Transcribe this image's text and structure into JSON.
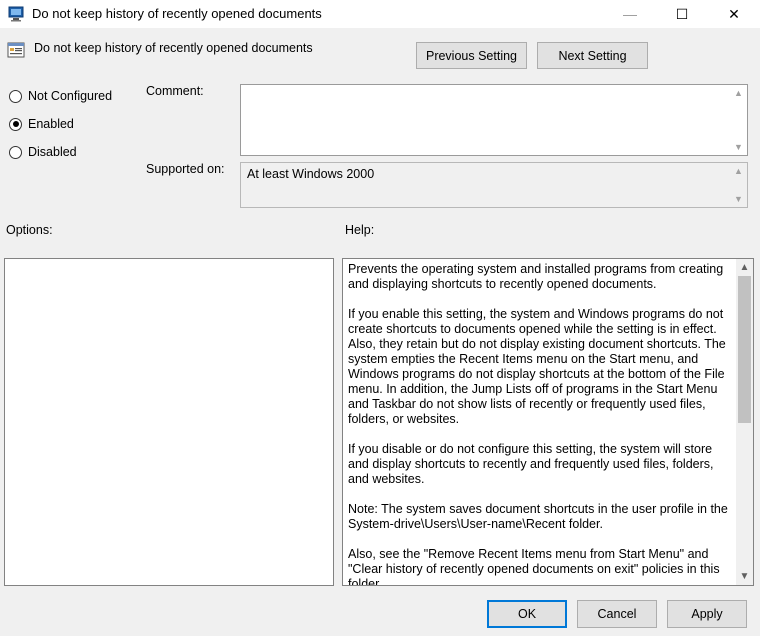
{
  "window": {
    "title": "Do not keep history of recently opened documents",
    "minimize_glyph": "—",
    "maximize_glyph": "☐",
    "close_glyph": "✕"
  },
  "header": {
    "title": "Do not keep history of recently opened documents",
    "previous_setting_label": "Previous Setting",
    "next_setting_label": "Next Setting"
  },
  "state": {
    "options": [
      {
        "label": "Not Configured",
        "checked": false
      },
      {
        "label": "Enabled",
        "checked": true
      },
      {
        "label": "Disabled",
        "checked": false
      }
    ]
  },
  "comment": {
    "label": "Comment:",
    "value": ""
  },
  "supported": {
    "label": "Supported on:",
    "value": "At least Windows 2000"
  },
  "options_panel": {
    "label": "Options:"
  },
  "help_panel": {
    "label": "Help:",
    "paragraphs": [
      "Prevents the operating system and installed programs from creating and displaying shortcuts to recently opened documents.",
      "If you enable this setting, the system and Windows programs do not create shortcuts to documents opened while the setting is in effect. Also, they retain but do not display existing document shortcuts. The system empties the Recent Items menu on the Start menu, and Windows programs do not display shortcuts at the bottom of the File menu. In addition, the Jump Lists off of programs in the Start Menu and Taskbar do not show lists of recently or frequently used files, folders, or websites.",
      "If you disable or do not configure this setting, the system will store and display shortcuts to recently and frequently used files, folders, and websites.",
      "Note: The system saves document shortcuts in the user profile in the System-drive\\Users\\User-name\\Recent folder.",
      "Also, see the \"Remove Recent Items menu from Start Menu\" and \"Clear history of recently opened documents on exit\" policies in this folder."
    ]
  },
  "footer": {
    "ok_label": "OK",
    "cancel_label": "Cancel",
    "apply_label": "Apply"
  },
  "colors": {
    "accent": "#0078d7",
    "dialog_bg": "#f0f0f0"
  }
}
